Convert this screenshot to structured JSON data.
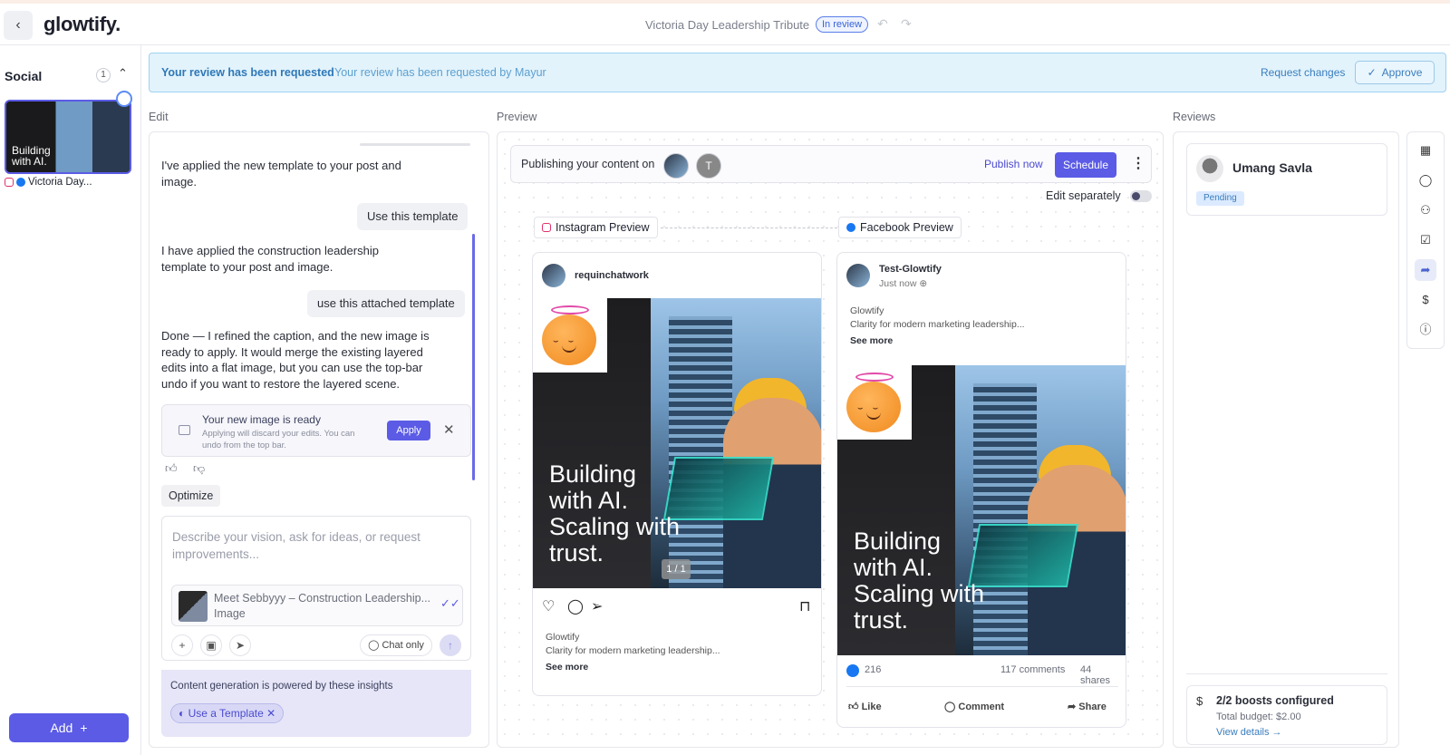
{
  "topbar": {
    "logo": "glowtify.",
    "doc_title": "Victoria Day Leadership Tribute",
    "status": "In review"
  },
  "sidebar": {
    "title": "Social",
    "count": "1",
    "thumb_text_1": "Building",
    "thumb_text_2": "with AI.",
    "item_label": "Victoria Day...",
    "add_label": "Add"
  },
  "banner": {
    "title": "Your review has been requested",
    "subtitle": "Your review has been requested by Mayur",
    "request_changes": "Request changes",
    "approve": "Approve"
  },
  "sections": {
    "edit": "Edit",
    "preview": "Preview",
    "reviews": "Reviews"
  },
  "chat": {
    "msg1": "I've applied the new template to your post and image.",
    "user1": "Use this template",
    "msg2": "I have applied the construction leadership template to your post and image.",
    "user2": "use this attached template",
    "msg3": "Done — I refined the caption, and the new image is ready to apply. It would merge the existing layered edits into a flat image, but you can use the top-bar undo if you want to restore the layered scene.",
    "ready_title": "Your new image is ready",
    "ready_sub": "Applying will discard your edits. You can undo from the top bar.",
    "apply": "Apply",
    "optimize": "Optimize",
    "composer_placeholder": "Describe your vision, ask for ideas, or request improvements...",
    "attach_title": "Meet Sebbyyy – Construction Leadership...",
    "attach_type": "Image",
    "chat_only": "Chat only",
    "insights_title": "Content generation is powered by these insights",
    "template_chip": "Use a Template"
  },
  "preview": {
    "publishing_label": "Publishing your content on",
    "avatar_letter": "T",
    "publish_now": "Publish now",
    "schedule": "Schedule",
    "edit_separately": "Edit separately",
    "ig_chip": "Instagram Preview",
    "fb_chip": "Facebook Preview",
    "headline_1": "Building",
    "headline_2": "with AI.",
    "headline_3": "Scaling with",
    "headline_4": "trust.",
    "ig": {
      "handle": "requinchatwork",
      "counter": "1 / 1",
      "brand": "Glowtify",
      "caption": "Clarity for modern marketing leadership...",
      "see_more": "See more"
    },
    "fb": {
      "name": "Test-Glowtify",
      "time": "Just now",
      "brand": "Glowtify",
      "caption": "Clarity for modern marketing leadership...",
      "see_more": "See more",
      "reactions": "216",
      "comments": "117 comments",
      "shares": "44 shares",
      "like": "Like",
      "comment": "Comment",
      "share": "Share"
    }
  },
  "reviews": {
    "reviewer_name": "Umang Savla",
    "reviewer_status": "Pending",
    "boost_title": "2/2 boosts configured",
    "boost_budget": "Total budget: $2.00",
    "boost_link": "View details →"
  },
  "colors": {
    "accent": "#5b5be6",
    "banner_bg": "#e2f3fc",
    "facebook": "#1877f2",
    "instagram": "#e1306c"
  }
}
